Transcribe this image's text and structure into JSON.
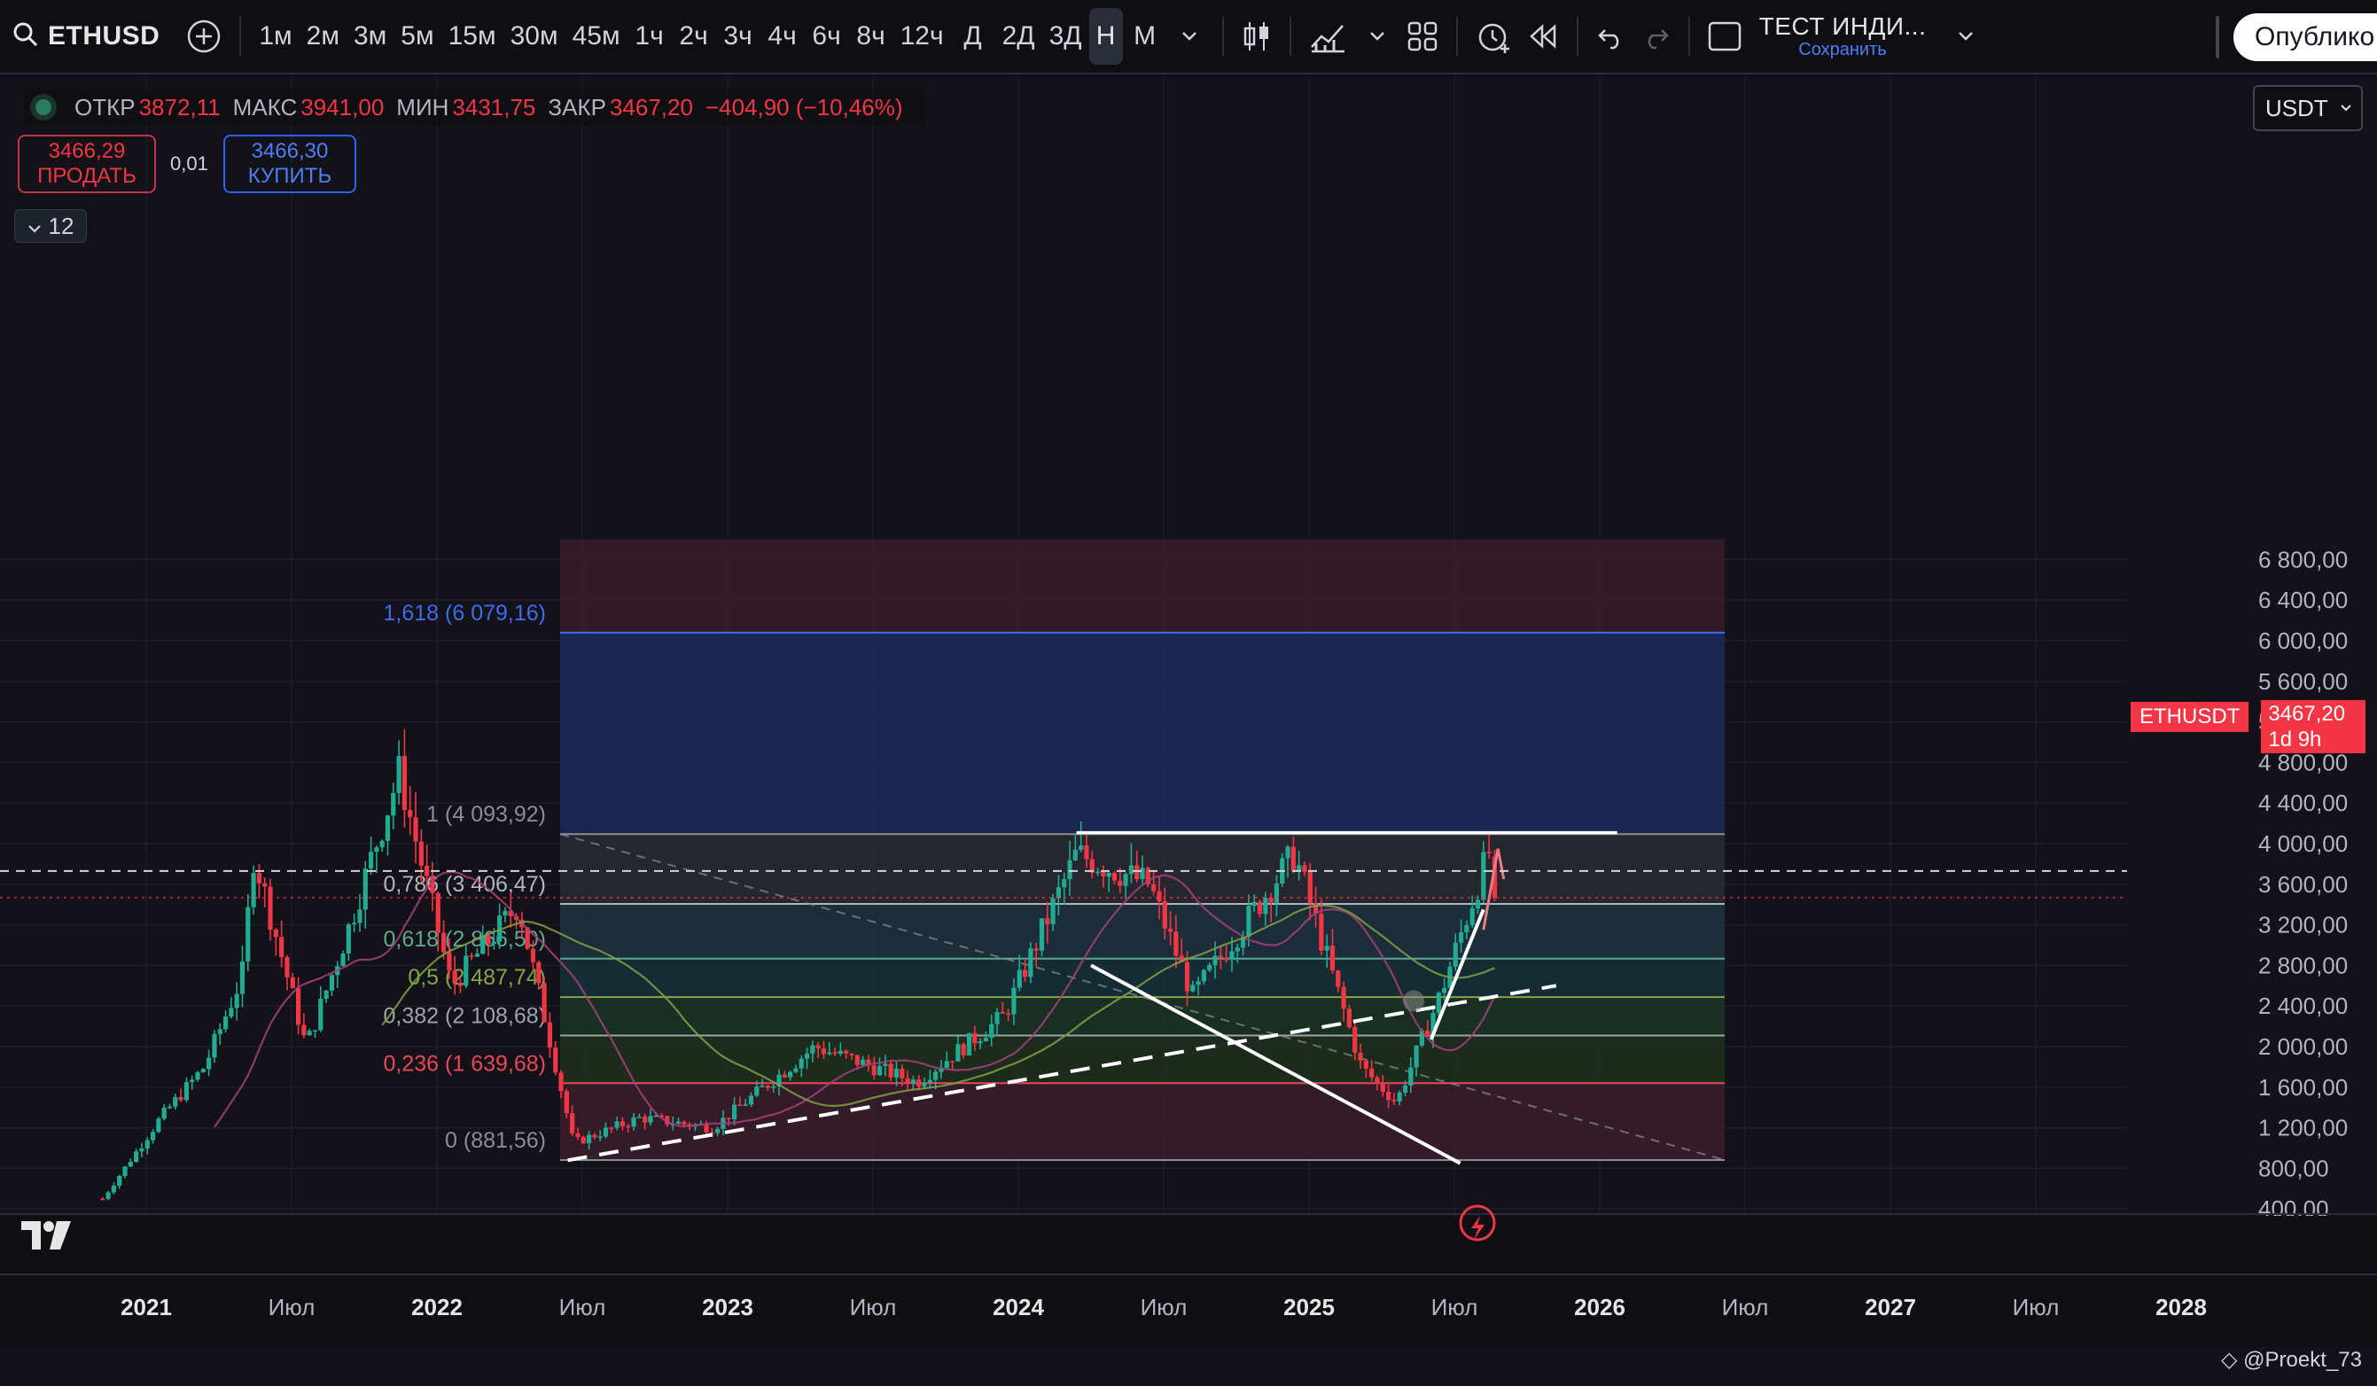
{
  "toolbar": {
    "symbol": "ETHUSD",
    "intervals": [
      "1м",
      "2м",
      "3м",
      "5м",
      "15м",
      "30м",
      "45м",
      "1ч",
      "2ч",
      "3ч",
      "4ч",
      "6ч",
      "8ч",
      "12ч",
      "Д",
      "2Д",
      "3Д",
      "Н",
      "М"
    ],
    "active_interval": "Н",
    "indicator_name": "ТЕСТ ИНДИ...",
    "indicator_save": "Сохранить",
    "publish_label": "Опублико"
  },
  "legend": {
    "open_label": "ОТКР",
    "open": "3872,11",
    "high_label": "МАКС",
    "high": "3941,00",
    "low_label": "МИН",
    "low": "3431,75",
    "close_label": "ЗАКР",
    "close": "3467,20",
    "change": "−404,90 (−10,46%)"
  },
  "trade": {
    "sell_price": "3466,29",
    "sell_label": "ПРОДАТЬ",
    "spread": "0,01",
    "buy_price": "3466,30",
    "buy_label": "КУПИТЬ"
  },
  "interval_badge": "12",
  "currency": "USDT",
  "price_tag": {
    "symbol": "ETHUSDT",
    "price": "3467,20",
    "countdown": "1d 9h"
  },
  "watermark": "@Proekt_73",
  "colors": {
    "up": "#22ab94",
    "down": "#f23645",
    "accent": "#2962ff",
    "fib_top": "#3d1f2c",
    "fib_blue": "#1a2a5a"
  },
  "price_axis": {
    "ticks": [
      "6 800,00",
      "6 400,00",
      "6 000,00",
      "5 600,00",
      "5 200,00",
      "4 800,00",
      "4 400,00",
      "4 000,00",
      "3 600,00",
      "3 200,00",
      "2 800,00",
      "2 400,00",
      "2 000,00",
      "1 600,00",
      "1 200,00",
      "800,00",
      "400,00"
    ],
    "values": [
      6800,
      6400,
      6000,
      5600,
      5200,
      4800,
      4400,
      4000,
      3600,
      3200,
      2800,
      2400,
      2000,
      1600,
      1200,
      800,
      400
    ]
  },
  "time_axis": {
    "labels": [
      "2021",
      "Июл",
      "2022",
      "Июл",
      "2023",
      "Июл",
      "2024",
      "Июл",
      "2025",
      "Июл",
      "2026",
      "Июл",
      "2027",
      "Июл",
      "2028"
    ],
    "bold": [
      true,
      false,
      true,
      false,
      true,
      false,
      true,
      false,
      true,
      false,
      true,
      false,
      true,
      false,
      true
    ]
  },
  "fib_levels": [
    {
      "label": "1,618 (6 079,16)",
      "value": 6079.16,
      "color": "#3d6cf0"
    },
    {
      "label": "1 (4 093,92)",
      "value": 4093.92,
      "color": "#8a8d96"
    },
    {
      "label": "0,786 (3 406,47)",
      "value": 3406.47,
      "color": "#b2b5be"
    },
    {
      "label": "0,618 (2 866,50)",
      "value": 2866.5,
      "color": "#5fa894"
    },
    {
      "label": "0,5 (2 487,74)",
      "value": 2487.74,
      "color": "#84a34a"
    },
    {
      "label": "0,382 (2 108,68)",
      "value": 2108.68,
      "color": "#9ea3a8"
    },
    {
      "label": "0,236 (1 639,68)",
      "value": 1639.68,
      "color": "#e8485a"
    },
    {
      "label": "0 (881,56)",
      "value": 881.56,
      "color": "#8a8d96"
    }
  ],
  "chart_data": {
    "type": "candlestick",
    "symbol": "ETHUSD",
    "timeframe": "weekly",
    "ylim": [
      200,
      7000
    ],
    "log_scale": false,
    "approx_weekly_close_path": [
      {
        "date": "2020-11",
        "close": 500
      },
      {
        "date": "2021-01",
        "close": 1300
      },
      {
        "date": "2021-03",
        "close": 1800
      },
      {
        "date": "2021-05",
        "close": 2700
      },
      {
        "date": "2021-05b",
        "close": 3900
      },
      {
        "date": "2021-07",
        "close": 2000
      },
      {
        "date": "2021-09",
        "close": 3200
      },
      {
        "date": "2021-11",
        "close": 4700
      },
      {
        "date": "2022-01",
        "close": 2600
      },
      {
        "date": "2022-04",
        "close": 3400
      },
      {
        "date": "2022-06",
        "close": 1050
      },
      {
        "date": "2022-09",
        "close": 1300
      },
      {
        "date": "2022-12",
        "close": 1200
      },
      {
        "date": "2023-04",
        "close": 2000
      },
      {
        "date": "2023-08",
        "close": 1650
      },
      {
        "date": "2023-12",
        "close": 2300
      },
      {
        "date": "2024-03",
        "close": 3900
      },
      {
        "date": "2024-06",
        "close": 3600
      },
      {
        "date": "2024-08",
        "close": 2500
      },
      {
        "date": "2024-12",
        "close": 3900
      },
      {
        "date": "2025-03",
        "close": 1800
      },
      {
        "date": "2025-04",
        "close": 1450
      },
      {
        "date": "2025-06",
        "close": 2500
      },
      {
        "date": "2025-08",
        "close": 3930
      },
      {
        "date": "2025-08b",
        "close": 3467
      }
    ],
    "current_price": 3467.2,
    "dashed_crosshair_price": 3730
  }
}
